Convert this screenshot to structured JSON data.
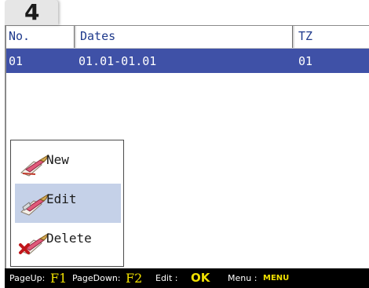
{
  "step": {
    "number": "4"
  },
  "table": {
    "headers": {
      "no": "No.",
      "dates": "Dates",
      "tz": "TZ"
    },
    "rows": [
      {
        "no": "01",
        "dates": "01.01-01.01",
        "tz": "01"
      }
    ]
  },
  "popup_menu": {
    "items": [
      {
        "label": "New",
        "icon": "new-icon"
      },
      {
        "label": "Edit",
        "icon": "edit-icon",
        "selected": true
      },
      {
        "label": "Delete",
        "icon": "delete-icon"
      }
    ]
  },
  "footer": {
    "pageup_label": "PageUp:",
    "pageup_key": "F1",
    "pagedown_label": "PageDown:",
    "pagedown_key": "F2",
    "edit_label": "Edit :",
    "edit_key": "OK",
    "menu_label": "Menu :",
    "menu_key": "MENU"
  },
  "colors": {
    "selected_row": "#3f51a7",
    "selected_menu_item": "#c5d1e8",
    "header_text": "#1f3a8c",
    "footer_background": "#000000",
    "footer_key": "#f0e000"
  }
}
